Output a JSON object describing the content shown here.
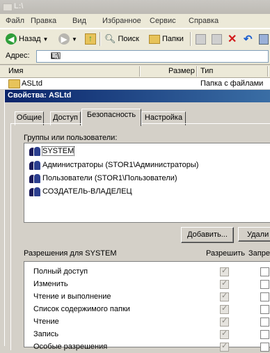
{
  "window": {
    "title": "L:\\"
  },
  "menu": [
    "Файл",
    "Правка",
    "Вид",
    "Избранное",
    "Сервис",
    "Справка"
  ],
  "toolbar": {
    "back": "Назад",
    "search": "Поиск",
    "folders": "Папки"
  },
  "address": {
    "label": "Адрес:",
    "value": "L:\\"
  },
  "columns": {
    "name": "Имя",
    "size": "Размер",
    "type": "Тип"
  },
  "file": {
    "name": "ASLtd",
    "type": "Папка с файлами"
  },
  "dialog": {
    "title": "Свойства: ASLtd",
    "tabs": [
      "Общие",
      "Доступ",
      "Безопасность",
      "Настройка"
    ],
    "groups_label": "Группы или пользователи:",
    "users": [
      "SYSTEM",
      "Администраторы (STOR1\\Администраторы)",
      "Пользователи (STOR1\\Пользователи)",
      "СОЗДАТЕЛЬ-ВЛАДЕЛЕЦ"
    ],
    "add_button": "Добавить...",
    "remove_button": "Удали",
    "perm_label": "Разрешения для SYSTEM",
    "allow_label": "Разрешить",
    "deny_label": "Запрет",
    "permissions": [
      "Полный доступ",
      "Изменить",
      "Чтение и выполнение",
      "Список содержимого папки",
      "Чтение",
      "Запись",
      "Особые разрешения"
    ]
  }
}
